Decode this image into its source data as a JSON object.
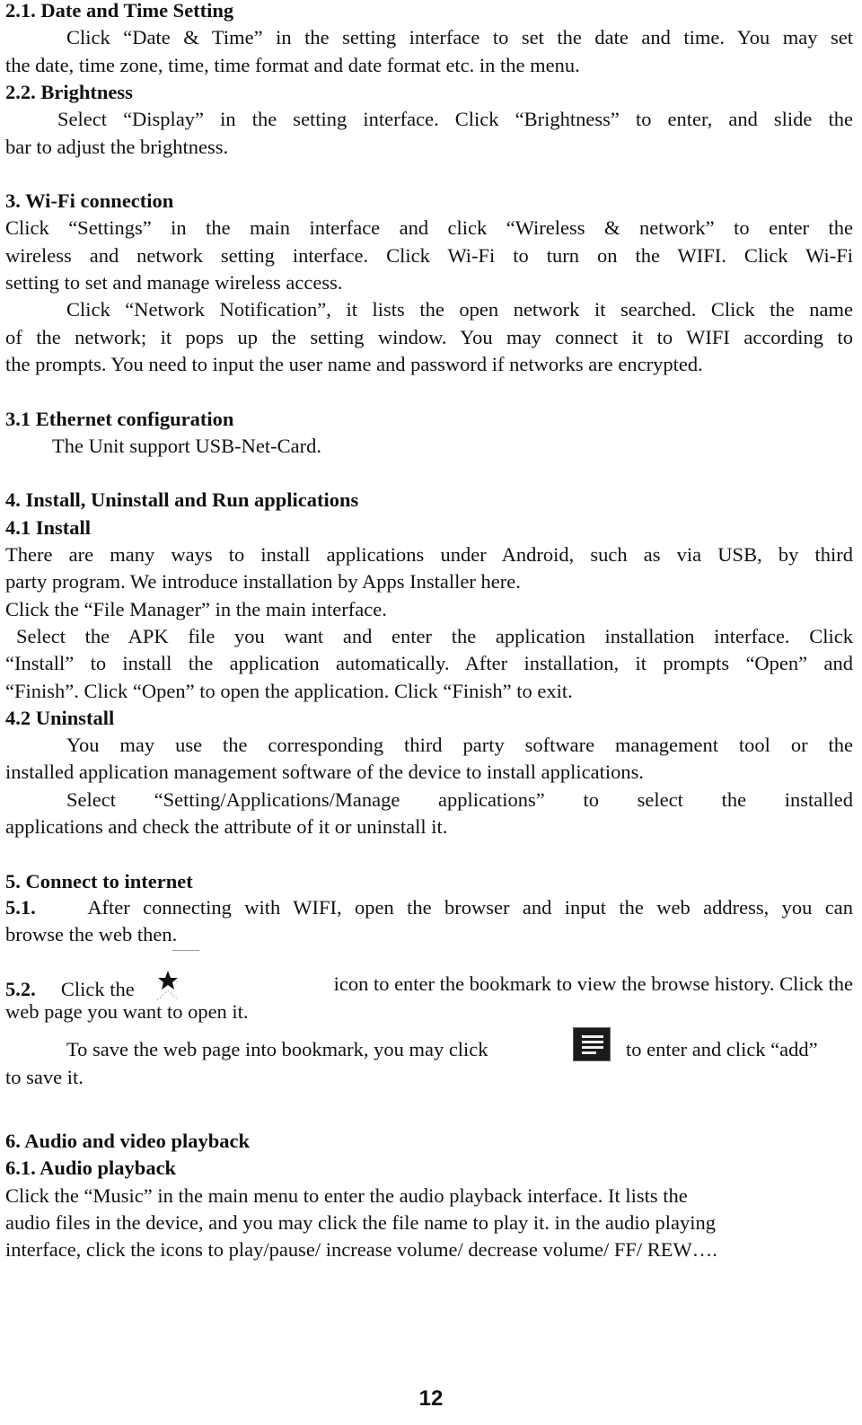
{
  "doc": {
    "lines": [
      {
        "t": "2.1.   Date and Time Setting",
        "bold": true
      },
      {
        "t": "Click “Date & Time” in the setting interface to set the date and time. You may set",
        "indent": 68,
        "justify": true
      },
      {
        "t": "the date, time zone, time, time format and date format etc. in the menu."
      },
      {
        "t": "2.2.    Brightness",
        "bold": true
      },
      {
        "t": "Select “Display” in the setting interface. Click “Brightness” to enter, and slide the",
        "indent": 58,
        "justify": true
      },
      {
        "t": "bar to adjust the brightness."
      },
      {
        "t": ""
      },
      {
        "t": "3. Wi-Fi connection",
        "bold": true
      },
      {
        "t": "Click “Settings” in the main interface and click “Wireless & network” to enter the",
        "justify": true
      },
      {
        "t": "wireless and network setting interface. Click Wi-Fi to turn on the WIFI. Click Wi-Fi",
        "justify": true
      },
      {
        "t": "setting to set and manage wireless access."
      },
      {
        "t": "Click “Network Notification”, it lists the open network it searched. Click the name",
        "indent": 68,
        "justify": true
      },
      {
        "t": "of the network; it pops up the setting window. You may connect it to WIFI according to",
        "justify": true
      },
      {
        "t": "the prompts. You need to input the user name and password if networks are encrypted."
      },
      {
        "t": ""
      },
      {
        "t": "3.1 Ethernet configuration",
        "bold": true
      },
      {
        "t": "The Unit support USB-Net-Card.",
        "indent": 52
      },
      {
        "t": ""
      },
      {
        "t": "4. Install, Uninstall and Run applications",
        "bold": true
      },
      {
        "t": "4.1 Install",
        "bold": true
      },
      {
        "t": "There are many ways to install applications under Android, such as via USB, by third",
        "justify": true
      },
      {
        "t": "party program. We introduce installation by Apps Installer here."
      },
      {
        "t": "Click the “File Manager” in the main interface."
      },
      {
        "t": "Select the APK file you want and enter the application installation interface. Click",
        "indent": 12,
        "justify": true
      },
      {
        "t": "“Install” to install the application automatically. After installation, it prompts “Open” and",
        "justify": true
      },
      {
        "t": "“Finish”. Click “Open” to open the application. Click “Finish” to exit."
      },
      {
        "t": "4.2 Uninstall",
        "bold": true
      },
      {
        "t": "You may use the corresponding third party software management tool or the",
        "indent": 68,
        "justify": true
      },
      {
        "t": "installed application management software of the device to install applications."
      },
      {
        "t": "Select “Setting/Applications/Manage applications” to select the installed",
        "indent": 68,
        "justify": true
      },
      {
        "t": "applications and check the attribute of it or uninstall it."
      },
      {
        "t": ""
      },
      {
        "t": "5. Connect to internet",
        "bold": true
      }
    ],
    "s51_num": "5.1.",
    "s51_text": "After connecting with WIFI, open the browser and input the web address, you can",
    "s51_cont": "browse the web then.",
    "s52_num": "5.2.",
    "s52_pre": "Click the",
    "s52_post": "icon to enter the bookmark to view the browse history. Click the",
    "s52_cont": "web page you want to open it.",
    "save_pre": "To save the web page into bookmark, you may click",
    "save_post": "to enter and click “add”",
    "save_cont": "to save it.",
    "tail": [
      {
        "t": "6. Audio and video playback",
        "bold": true
      },
      {
        "t": "6.1. Audio playback",
        "bold": true
      },
      {
        "t": "Click the “Music” in the main menu to enter the audio playback interface. It lists the"
      },
      {
        "t": "audio files in the device, and you may click the file name to play it. in the audio playing"
      },
      {
        "t": "interface, click the icons to play/pause/ increase volume/ decrease volume/ FF/ REW…."
      }
    ],
    "icons": {
      "bookmark": "bookmark-star-icon",
      "menu": "menu-icon"
    },
    "page_number": "12"
  }
}
